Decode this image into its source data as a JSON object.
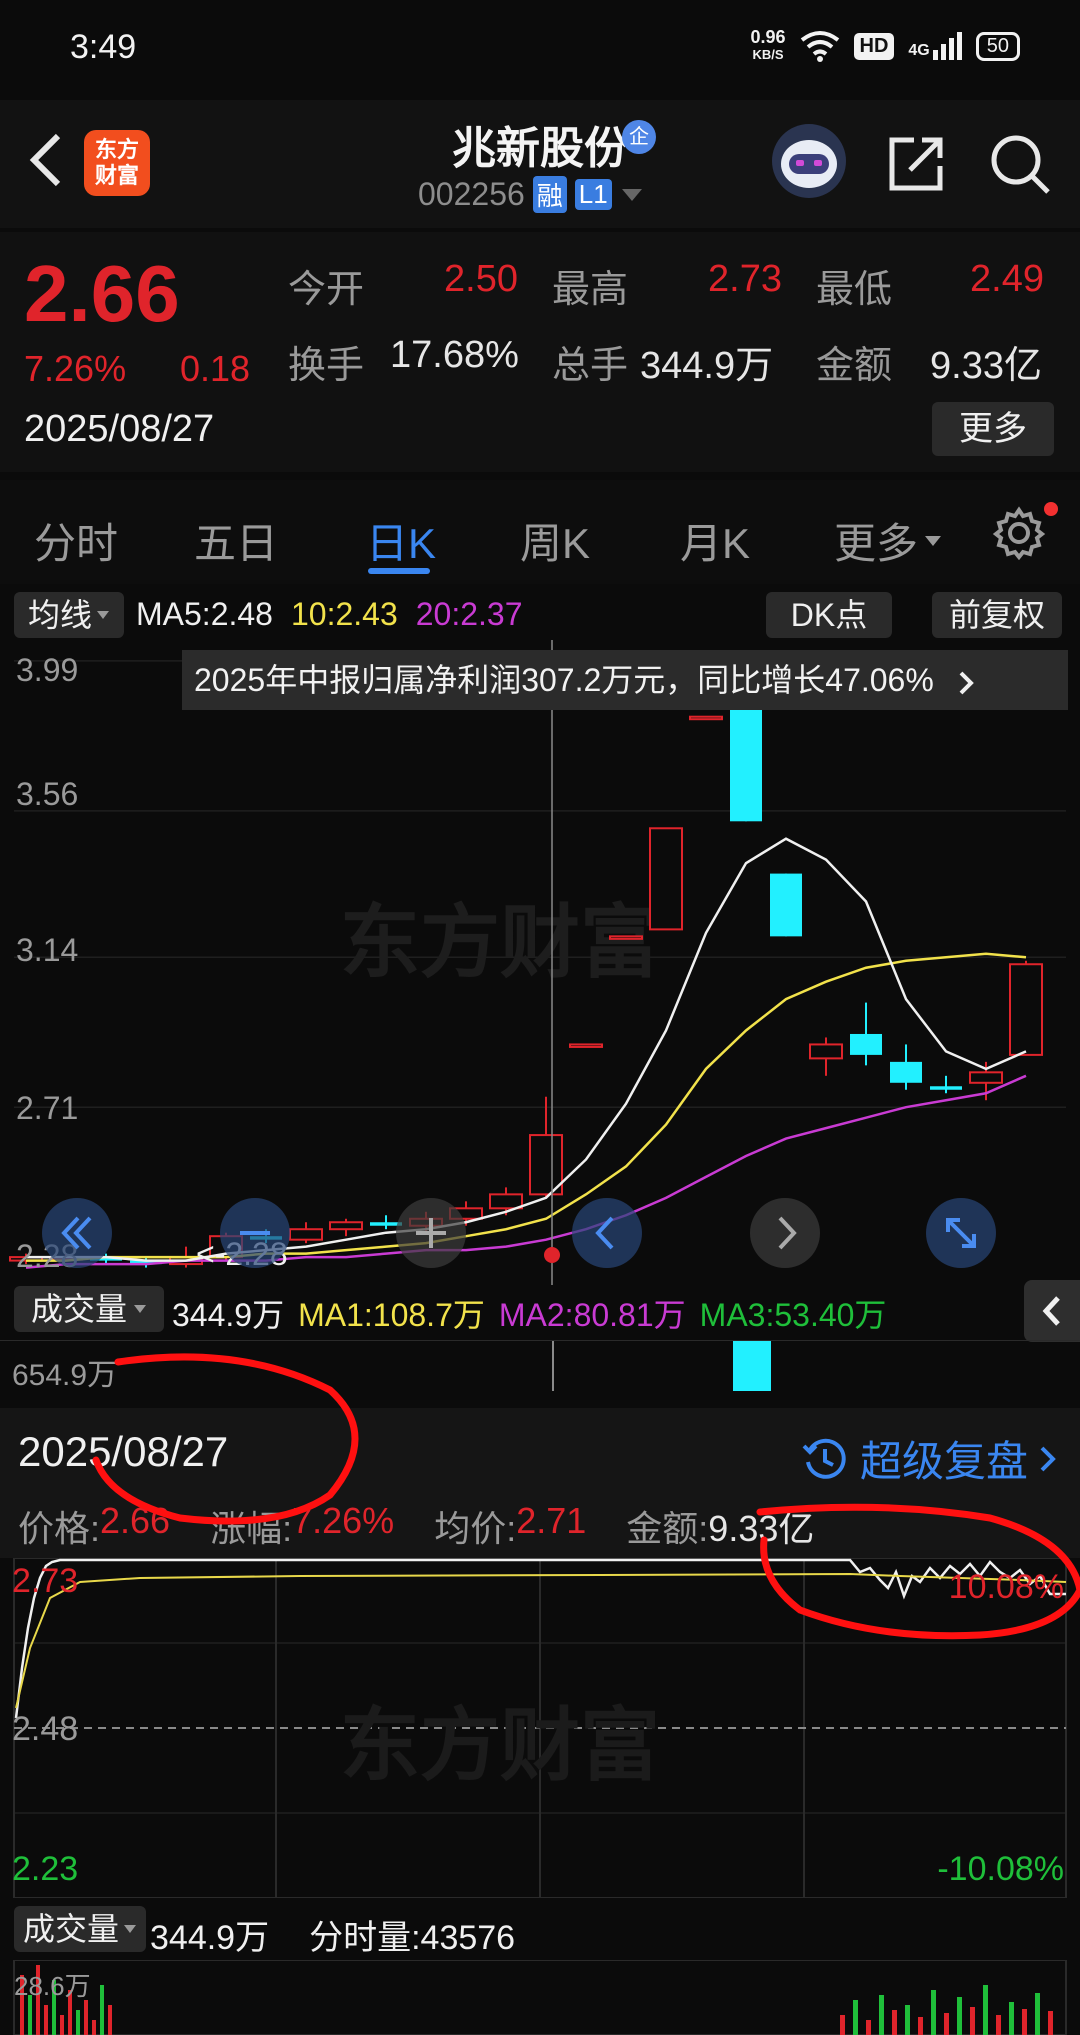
{
  "status_bar": {
    "time": "3:49",
    "net_speed": "0.96",
    "net_speed_unit": "KB/S",
    "hd": "HD",
    "signal": "4G",
    "battery": "50"
  },
  "header": {
    "logo_text": "东方\n财富",
    "stock_name": "兆新股份",
    "enterprise_badge": "企",
    "stock_code": "002256",
    "tag_margin": "融",
    "tag_level": "L1"
  },
  "quote": {
    "price": "2.66",
    "change_pct": "7.26%",
    "change_amt": "0.18",
    "date": "2025/08/27",
    "open_label": "今开",
    "open": "2.50",
    "high_label": "最高",
    "high": "2.73",
    "low_label": "最低",
    "low": "2.49",
    "turnover_label": "换手",
    "turnover": "17.68%",
    "volume_label": "总手",
    "volume": "344.9万",
    "amount_label": "金额",
    "amount": "9.33亿",
    "more_label": "更多"
  },
  "tabs": {
    "items": [
      "分时",
      "五日",
      "日K",
      "周K",
      "月K",
      "更多"
    ],
    "active": "日K"
  },
  "kline_toolbar": {
    "ma_button": "均线",
    "ma5": "MA5:2.48",
    "ma10": "10:2.43",
    "ma20": "20:2.37",
    "dk_button": "DK点",
    "adjust_button": "前复权",
    "news": "2025年中报归属净利润307.2万元，同比增长47.06%"
  },
  "kline_axis": {
    "labels": [
      "3.99",
      "3.56",
      "3.14",
      "2.71",
      "2.28"
    ],
    "min_marker": "<-2.28"
  },
  "kline": {
    "ohlc": [
      [
        2.27,
        2.29,
        2.26,
        2.28
      ],
      [
        2.28,
        2.29,
        2.27,
        2.28
      ],
      [
        2.28,
        2.29,
        2.26,
        2.27
      ],
      [
        2.27,
        2.28,
        2.25,
        2.26
      ],
      [
        2.26,
        2.31,
        2.25,
        2.28
      ],
      [
        2.28,
        2.35,
        2.27,
        2.34
      ],
      [
        2.34,
        2.36,
        2.32,
        2.33
      ],
      [
        2.33,
        2.38,
        2.32,
        2.36
      ],
      [
        2.36,
        2.39,
        2.34,
        2.38
      ],
      [
        2.38,
        2.4,
        2.36,
        2.37
      ],
      [
        2.37,
        2.41,
        2.35,
        2.39
      ],
      [
        2.39,
        2.44,
        2.37,
        2.42
      ],
      [
        2.42,
        2.48,
        2.4,
        2.46
      ],
      [
        2.46,
        2.74,
        2.45,
        2.63
      ],
      [
        2.89,
        2.89,
        2.89,
        2.89
      ],
      [
        3.2,
        3.2,
        3.2,
        3.2
      ],
      [
        3.22,
        3.51,
        3.22,
        3.51
      ],
      [
        3.83,
        3.83,
        3.83,
        3.83
      ],
      [
        3.92,
        3.92,
        3.53,
        3.53
      ],
      [
        3.38,
        3.38,
        3.2,
        3.2
      ],
      [
        2.85,
        2.91,
        2.8,
        2.89
      ],
      [
        2.92,
        3.01,
        2.83,
        2.86
      ],
      [
        2.84,
        2.89,
        2.76,
        2.78
      ],
      [
        2.77,
        2.8,
        2.75,
        2.76
      ],
      [
        2.78,
        2.84,
        2.73,
        2.81
      ],
      [
        2.86,
        3.13,
        2.86,
        3.12
      ]
    ],
    "ma5": [
      2.28,
      2.28,
      2.28,
      2.27,
      2.27,
      2.29,
      2.3,
      2.31,
      2.33,
      2.35,
      2.36,
      2.38,
      2.41,
      2.45,
      2.56,
      2.72,
      2.93,
      3.21,
      3.41,
      3.48,
      3.42,
      3.3,
      3.02,
      2.87,
      2.82,
      2.87
    ],
    "ma10": [
      2.27,
      2.27,
      2.28,
      2.28,
      2.28,
      2.28,
      2.29,
      2.29,
      2.3,
      2.31,
      2.32,
      2.34,
      2.36,
      2.39,
      2.46,
      2.54,
      2.66,
      2.82,
      2.93,
      3.02,
      3.07,
      3.11,
      3.13,
      3.14,
      3.15,
      3.14
    ],
    "ma20": [
      2.25,
      2.26,
      2.26,
      2.26,
      2.27,
      2.27,
      2.27,
      2.28,
      2.28,
      2.29,
      2.3,
      2.3,
      2.31,
      2.33,
      2.36,
      2.4,
      2.45,
      2.51,
      2.57,
      2.62,
      2.65,
      2.68,
      2.71,
      2.73,
      2.75,
      2.8
    ]
  },
  "volume_toolbar": {
    "label": "成交量",
    "vol": "344.9万",
    "ma1": "MA1:108.7万",
    "ma2": "MA2:80.81万",
    "ma3": "MA3:53.40万",
    "top_value": "654.9万"
  },
  "intraday": {
    "date": "2025/08/27",
    "replay_label": "超级复盘",
    "price_label": "价格:",
    "price": "2.66",
    "change_label": "涨幅:",
    "change": "7.26%",
    "avg_label": "均价:",
    "avg": "2.71",
    "amount_label": "金额:",
    "amount": "9.33亿",
    "axis_high": "2.73",
    "axis_mid": "2.48",
    "axis_low": "2.23",
    "pct_high": "10.08%",
    "pct_low": "-10.08%"
  },
  "intraday_volume": {
    "label": "成交量",
    "vol": "344.9万",
    "tick_label": "分时量:43576",
    "top_value": "28.6万"
  }
}
